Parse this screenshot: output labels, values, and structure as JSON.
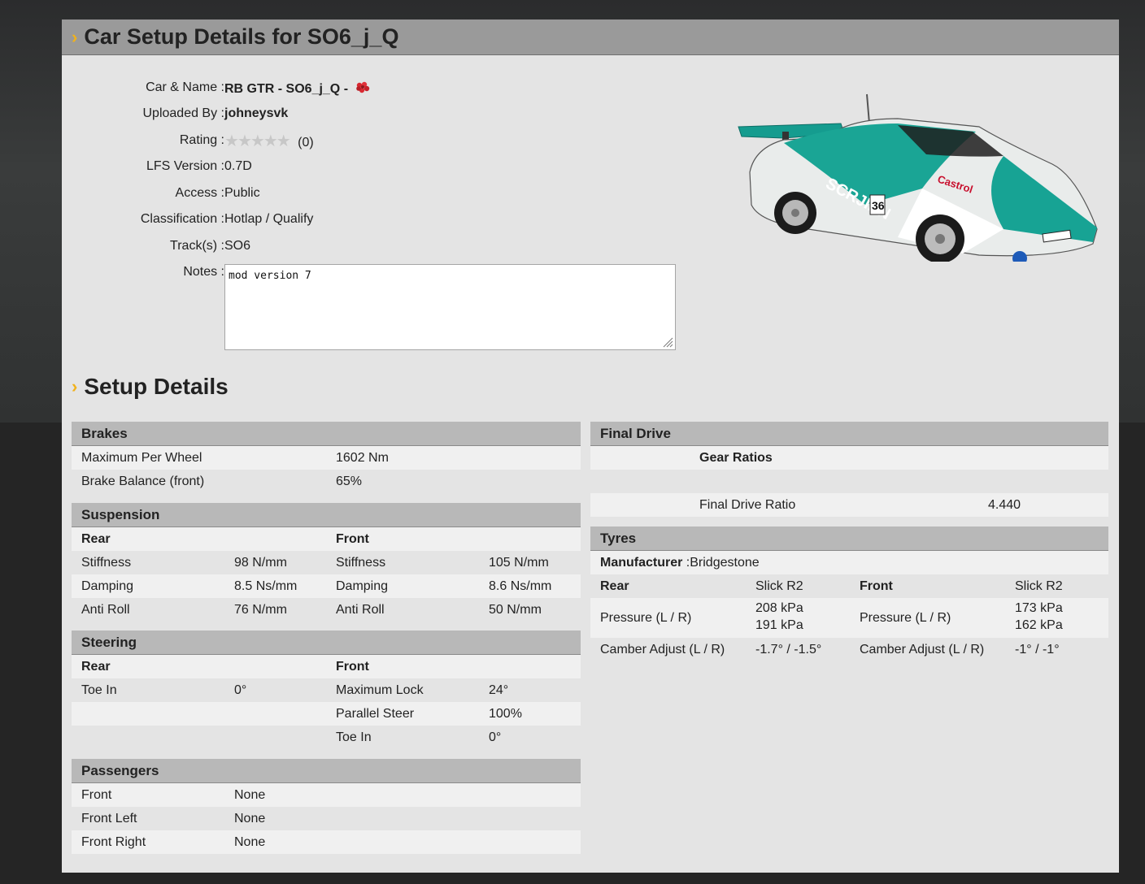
{
  "title": "Car Setup Details for SO6_j_Q",
  "info": {
    "car_label": "Car & Name :",
    "car_value": "RB GTR - SO6_j_Q -",
    "uploaded_label": "Uploaded By :",
    "uploaded_value": "johneysvk",
    "rating_label": "Rating :",
    "rating_count": "(0)",
    "rating_stars": 0,
    "lfs_label": "LFS Version :",
    "lfs_value": "0.7D",
    "access_label": "Access :",
    "access_value": "Public",
    "class_label": "Classification :",
    "class_value": "Hotlap / Qualify",
    "track_label": "Track(s) :",
    "track_value": "SO6",
    "notes_label": "Notes :",
    "notes_value": "mod version 7"
  },
  "setup_title": "Setup Details",
  "brakes": {
    "title": "Brakes",
    "max_label": "Maximum Per Wheel",
    "max_value": "1602 Nm",
    "balance_label": "Brake Balance (front)",
    "balance_value": "65%"
  },
  "suspension": {
    "title": "Suspension",
    "rear": "Rear",
    "front": "Front",
    "stiffness": "Stiffness",
    "rear_stiffness": "98 N/mm",
    "front_stiffness": "105 N/mm",
    "damping": "Damping",
    "rear_damping": "8.5 Ns/mm",
    "front_damping": "8.6 Ns/mm",
    "antiroll": "Anti Roll",
    "rear_antiroll": "76 N/mm",
    "front_antiroll": "50 N/mm"
  },
  "steering": {
    "title": "Steering",
    "rear": "Rear",
    "front": "Front",
    "toe_label": "Toe In",
    "rear_toe": "0°",
    "maxlock_label": "Maximum Lock",
    "maxlock_value": "24°",
    "parallel_label": "Parallel Steer",
    "parallel_value": "100%",
    "front_toe_label": "Toe In",
    "front_toe": "0°"
  },
  "passengers": {
    "title": "Passengers",
    "front_label": "Front",
    "front_value": "None",
    "front_left_label": "Front Left",
    "front_left_value": "None",
    "front_right_label": "Front Right",
    "front_right_value": "None"
  },
  "final_drive": {
    "title": "Final Drive",
    "gear_ratios": "Gear Ratios",
    "ratio_label": "Final Drive Ratio",
    "ratio_value": "4.440"
  },
  "tyres": {
    "title": "Tyres",
    "manufacturer_label": "Manufacturer",
    "manufacturer_value": "Bridgestone",
    "rear": "Rear",
    "rear_type": "Slick R2",
    "front": "Front",
    "front_type": "Slick R2",
    "pressure_label": "Pressure (L / R)",
    "rear_pressure_l": "208 kPa",
    "rear_pressure_r": "191 kPa",
    "front_pressure_l": "173 kPa",
    "front_pressure_r": "162 kPa",
    "camber_label": "Camber Adjust (L / R)",
    "rear_camber": "-1.7° / -1.5°",
    "front_camber": "-1° / -1°"
  },
  "colors": {
    "accent": "#f1b21b",
    "header": "#9a9a9a",
    "section_head": "#b8b8b8"
  }
}
